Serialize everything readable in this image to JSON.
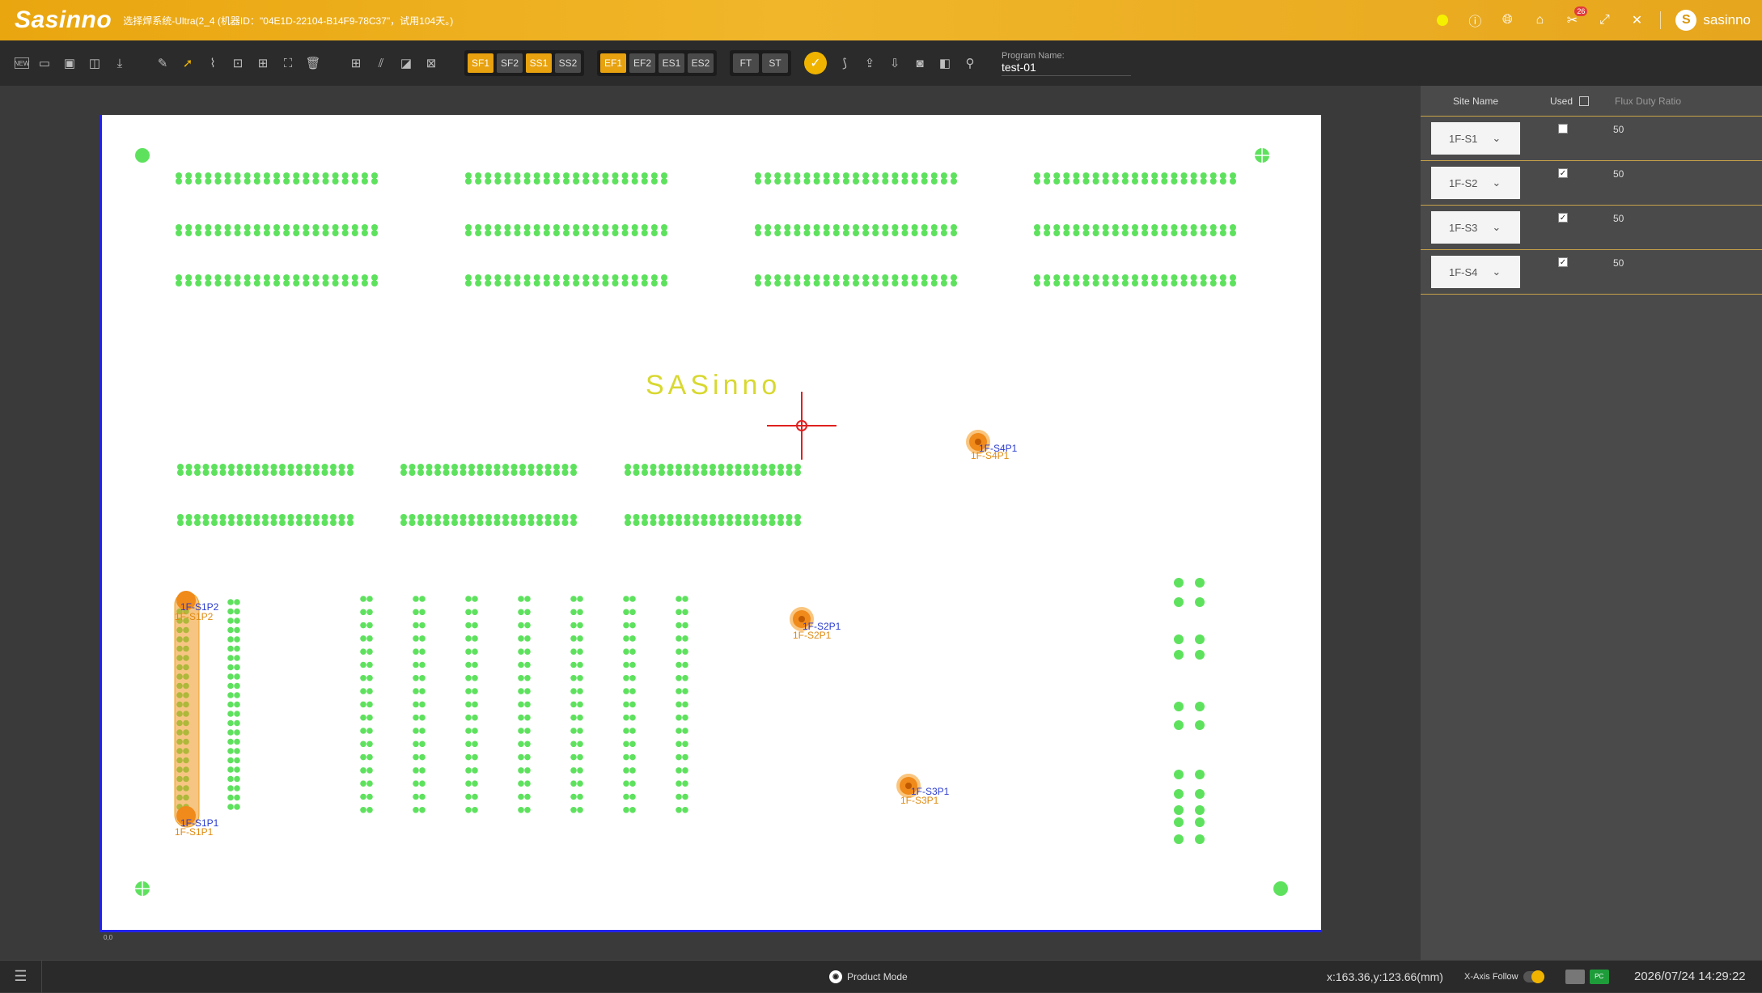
{
  "titlebar": {
    "logo": "Sasinno",
    "title": "选择焊系统-Ultra(2_4 (机器ID：\"04E1D-22104-B14F9-78C37\"，试用104天。)",
    "notification_count": "26",
    "username": "sasinno",
    "avatar_letter": "S"
  },
  "toolbar": {
    "new_label": "NEW",
    "group_sf": [
      {
        "label": "SF1",
        "on": true
      },
      {
        "label": "SF2",
        "on": false
      },
      {
        "label": "SS1",
        "on": true
      },
      {
        "label": "SS2",
        "on": false
      }
    ],
    "group_ef": [
      {
        "label": "EF1",
        "on": true
      },
      {
        "label": "EF2",
        "on": false
      },
      {
        "label": "ES1",
        "on": false
      },
      {
        "label": "ES2",
        "on": false
      }
    ],
    "group_ft": [
      {
        "label": "FT"
      },
      {
        "label": "ST"
      }
    ],
    "program_name_label": "Program Name:",
    "program_name_value": "test-01"
  },
  "board": {
    "logo_text": "SASinno",
    "origin_label": "0,0",
    "site_labels": [
      {
        "blue": "1F-S1P2",
        "orange": "1F-S1P2"
      },
      {
        "blue": "1F-S1P1",
        "orange": "1F-S1P1"
      },
      {
        "blue": "1F-S2P1",
        "orange": "1F-S2P1"
      },
      {
        "blue": "1F-S3P1",
        "orange": "1F-S3P1"
      },
      {
        "blue": "1F-S4P1",
        "orange": "1F-S4P1"
      }
    ]
  },
  "panel": {
    "col_site": "Site Name",
    "col_used": "Used",
    "col_flux": "Flux Duty Ratio",
    "rows": [
      {
        "site": "1F-S1",
        "used": false,
        "ratio": "50"
      },
      {
        "site": "1F-S2",
        "used": true,
        "ratio": "50"
      },
      {
        "site": "1F-S3",
        "used": true,
        "ratio": "50"
      },
      {
        "site": "1F-S4",
        "used": true,
        "ratio": "50"
      }
    ]
  },
  "statusbar": {
    "mode": "Product Mode",
    "coords": "x:163.36,y:123.66(mm)",
    "xaxis_follow": "X-Axis Follow",
    "datetime": "2026/07/24 14:29:22"
  },
  "colors": {
    "accent": "#e8a20f",
    "pad": "#5ee25e",
    "board_border": "#2222ee",
    "crosshair": "#e02020"
  }
}
